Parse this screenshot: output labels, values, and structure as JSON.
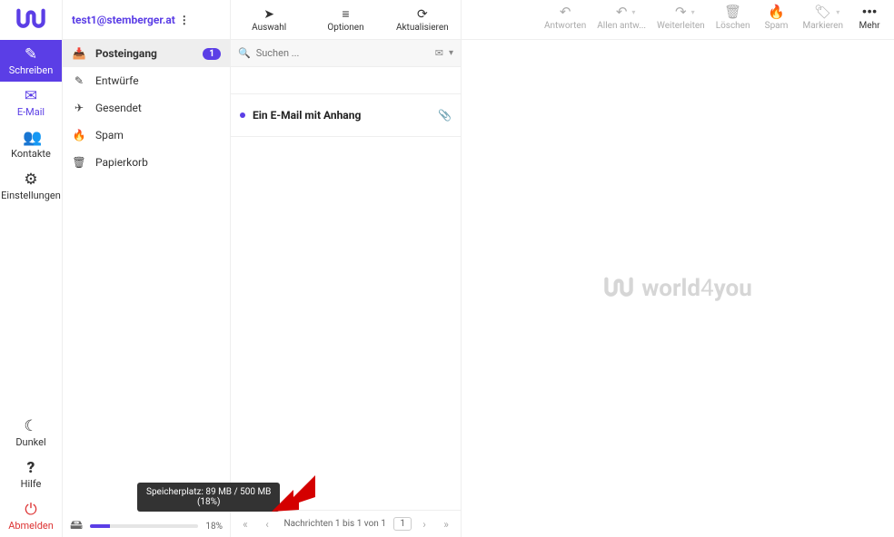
{
  "rail": {
    "compose": "Schreiben",
    "mail": "E-Mail",
    "contacts": "Kontakte",
    "settings": "Einstellungen",
    "dark": "Dunkel",
    "help": "Hilfe",
    "logout": "Abmelden"
  },
  "account": {
    "email": "test1@stemberger.at"
  },
  "folders": {
    "inbox": "Posteingang",
    "inbox_count": "1",
    "drafts": "Entwürfe",
    "sent": "Gesendet",
    "spam": "Spam",
    "trash": "Papierkorb"
  },
  "quota": {
    "percent": 18,
    "percent_label": "18%",
    "tooltip_line1": "Speicherplatz: 89 MB / 500 MB",
    "tooltip_line2": "(18%)"
  },
  "listToolbar": {
    "select": "Auswahl",
    "options": "Optionen",
    "refresh": "Aktualisieren"
  },
  "search": {
    "placeholder": "Suchen ..."
  },
  "messages": [
    {
      "subject": "Ein E-Mail mit Anhang",
      "unread": true,
      "attachment": true
    }
  ],
  "pager": {
    "info": "Nachrichten 1 bis 1 von 1",
    "page": "1"
  },
  "pvToolbar": {
    "reply": "Antworten",
    "replyall": "Allen antw...",
    "forward": "Weiterleiten",
    "delete": "Löschen",
    "spam": "Spam",
    "mark": "Markieren",
    "more": "Mehr"
  },
  "brand": "world4you"
}
